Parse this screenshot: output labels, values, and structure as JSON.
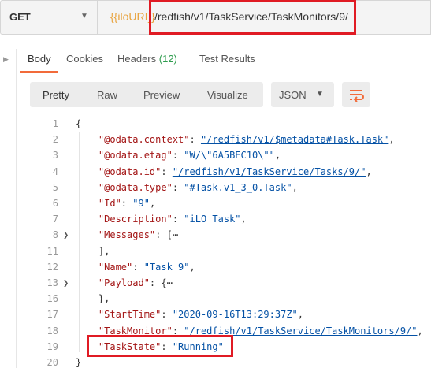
{
  "request": {
    "method": "GET",
    "url_variable": "{{iloURI}}",
    "url_path": "/redfish/v1/TaskService/TaskMonitors/9/"
  },
  "response_tabs": [
    {
      "label": "Body",
      "active": true
    },
    {
      "label": "Cookies"
    },
    {
      "label": "Headers",
      "count": "(12)"
    },
    {
      "label": "Test Results"
    }
  ],
  "view_modes": [
    "Pretty",
    "Raw",
    "Preview",
    "Visualize"
  ],
  "format": {
    "selected": "JSON"
  },
  "code_lines": [
    {
      "n": "1",
      "parts": [
        {
          "t": "{",
          "c": "punc"
        }
      ]
    },
    {
      "n": "2",
      "parts": [
        {
          "t": "    \"@odata.context\"",
          "c": "key"
        },
        {
          "t": ": ",
          "c": "punc"
        },
        {
          "t": "\"/redfish/v1/$metadata#Task.Task\"",
          "c": "link"
        },
        {
          "t": ",",
          "c": "punc"
        }
      ]
    },
    {
      "n": "3",
      "parts": [
        {
          "t": "    \"@odata.etag\"",
          "c": "key"
        },
        {
          "t": ": ",
          "c": "punc"
        },
        {
          "t": "\"W/\\\"6A5BEC10\\\"\"",
          "c": "str"
        },
        {
          "t": ",",
          "c": "punc"
        }
      ]
    },
    {
      "n": "4",
      "parts": [
        {
          "t": "    \"@odata.id\"",
          "c": "key"
        },
        {
          "t": ": ",
          "c": "punc"
        },
        {
          "t": "\"/redfish/v1/TaskService/Tasks/9/\"",
          "c": "link"
        },
        {
          "t": ",",
          "c": "punc"
        }
      ]
    },
    {
      "n": "5",
      "parts": [
        {
          "t": "    \"@odata.type\"",
          "c": "key"
        },
        {
          "t": ": ",
          "c": "punc"
        },
        {
          "t": "\"#Task.v1_3_0.Task\"",
          "c": "str"
        },
        {
          "t": ",",
          "c": "punc"
        }
      ]
    },
    {
      "n": "6",
      "parts": [
        {
          "t": "    \"Id\"",
          "c": "key"
        },
        {
          "t": ": ",
          "c": "punc"
        },
        {
          "t": "\"9\"",
          "c": "str"
        },
        {
          "t": ",",
          "c": "punc"
        }
      ]
    },
    {
      "n": "7",
      "parts": [
        {
          "t": "    \"Description\"",
          "c": "key"
        },
        {
          "t": ": ",
          "c": "punc"
        },
        {
          "t": "\"iLO Task\"",
          "c": "str"
        },
        {
          "t": ",",
          "c": "punc"
        }
      ]
    },
    {
      "n": "8",
      "fold": true,
      "parts": [
        {
          "t": "    \"Messages\"",
          "c": "key"
        },
        {
          "t": ": [",
          "c": "punc"
        },
        {
          "t": "⋯",
          "c": "punc"
        }
      ]
    },
    {
      "n": "11",
      "parts": [
        {
          "t": "    ],",
          "c": "punc"
        }
      ]
    },
    {
      "n": "12",
      "parts": [
        {
          "t": "    \"Name\"",
          "c": "key"
        },
        {
          "t": ": ",
          "c": "punc"
        },
        {
          "t": "\"Task 9\"",
          "c": "str"
        },
        {
          "t": ",",
          "c": "punc"
        }
      ]
    },
    {
      "n": "13",
      "fold": true,
      "parts": [
        {
          "t": "    \"Payload\"",
          "c": "key"
        },
        {
          "t": ": {",
          "c": "punc"
        },
        {
          "t": "⋯",
          "c": "punc"
        }
      ]
    },
    {
      "n": "16",
      "parts": [
        {
          "t": "    },",
          "c": "punc"
        }
      ]
    },
    {
      "n": "17",
      "parts": [
        {
          "t": "    \"StartTime\"",
          "c": "key"
        },
        {
          "t": ": ",
          "c": "punc"
        },
        {
          "t": "\"2020-09-16T13:29:37Z\"",
          "c": "str"
        },
        {
          "t": ",",
          "c": "punc"
        }
      ]
    },
    {
      "n": "18",
      "parts": [
        {
          "t": "    \"TaskMonitor\"",
          "c": "key"
        },
        {
          "t": ": ",
          "c": "punc"
        },
        {
          "t": "\"/redfish/v1/TaskService/TaskMonitors/9/\"",
          "c": "link"
        },
        {
          "t": ",",
          "c": "punc"
        }
      ]
    },
    {
      "n": "19",
      "parts": [
        {
          "t": "    \"TaskState\"",
          "c": "key"
        },
        {
          "t": ": ",
          "c": "punc"
        },
        {
          "t": "\"Running\"",
          "c": "str"
        }
      ]
    },
    {
      "n": "20",
      "parts": [
        {
          "t": "}",
          "c": "punc"
        }
      ]
    }
  ],
  "colors": {
    "highlight_box": "#e01b24",
    "active_tab_underline": "#f26b3a",
    "url_variable": "#e8a33d"
  }
}
